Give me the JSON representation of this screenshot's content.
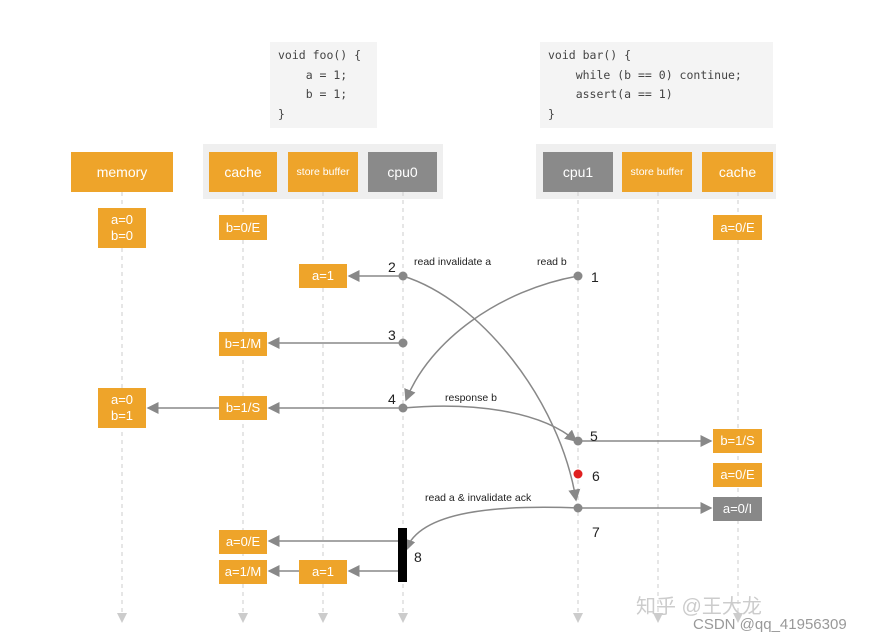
{
  "code_foo": [
    "void foo() {",
    "    a = 1;",
    "    b = 1;",
    "}"
  ],
  "code_bar": [
    "void bar() {",
    "    while (b == 0) continue;",
    "    assert(a == 1)",
    "}"
  ],
  "headers": {
    "memory": "memory",
    "cache0": "cache",
    "sb0": "store buffer",
    "cpu0": "cpu0",
    "cpu1": "cpu1",
    "sb1": "store buffer",
    "cache1": "cache"
  },
  "boxes": {
    "mem_init": [
      "a=0",
      "b=0"
    ],
    "cache0_init": "b=0/E",
    "cache1_init": "a=0/E",
    "sb0_a1": "a=1",
    "cache0_b1m": "b=1/M",
    "mem_after": [
      "a=0",
      "b=1"
    ],
    "cache0_b1s": "b=1/S",
    "cache1_b1s": "b=1/S",
    "cache1_a0e": "a=0/E",
    "cache1_a0i": "a=0/I",
    "cache0_a0e": "a=0/E",
    "cache0_a1m": "a=1/M",
    "sb0_a1_flush": "a=1"
  },
  "steps": [
    "1",
    "2",
    "3",
    "4",
    "5",
    "6",
    "7",
    "8"
  ],
  "labels": {
    "read_invalidate": "read invalidate a",
    "read_b": "read b",
    "response_b": "response b",
    "ack": "read a & invalidate ack"
  },
  "colors": {
    "orange": "#eea42a",
    "gray": "#888888",
    "red": "#e02020"
  },
  "watermark": "知乎 @王大龙",
  "credit": "CSDN @qq_41956309"
}
